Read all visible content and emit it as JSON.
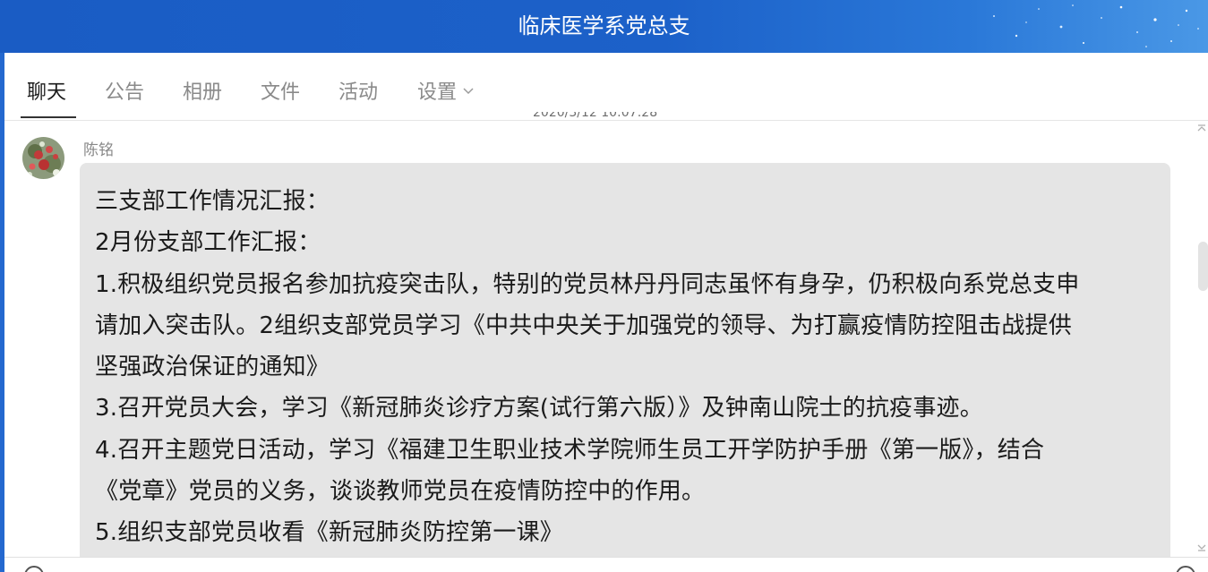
{
  "window": {
    "title": "临床医学系党总支"
  },
  "tabs": [
    {
      "label": "聊天",
      "active": true
    },
    {
      "label": "公告",
      "active": false
    },
    {
      "label": "相册",
      "active": false
    },
    {
      "label": "文件",
      "active": false
    },
    {
      "label": "活动",
      "active": false
    },
    {
      "label": "设置",
      "active": false
    }
  ],
  "chat": {
    "timestamp": "2020/3/12 10:07:28",
    "message": {
      "sender": "陈铭",
      "lines": [
        "三支部工作情况汇报：",
        "2月份支部工作汇报：",
        "1.积极组织党员报名参加抗疫突击队，特别的党员林丹丹同志虽怀有身孕，仍积极向系党总支申",
        "请加入突击队。2组织支部党员学习《中共中央关于加强党的领导、为打赢疫情防控阻击战提供",
        "坚强政治保证的通知》",
        "3.召开党员大会，学习《新冠肺炎诊疗方案(试行第六版）》及钟南山院士的抗疫事迹。",
        "4.召开主题党日活动，学习《福建卫生职业技术学院师生员工开学防护手册《第一版》，结合",
        "《党章》党员的义务，谈谈教师党员在疫情防控中的作用。",
        "5.组织支部党员收看《新冠肺炎防控第一课》"
      ]
    }
  },
  "colors": {
    "titlebar": "#1c61c9",
    "bubble": "#e5e5e5",
    "active_tab": "#1a1a1a",
    "inactive_tab": "#8a8a8a"
  },
  "icons": [
    "chevron-down-icon",
    "avatar-flower",
    "scroll-up-icon",
    "scroll-down-icon",
    "emoji-icon"
  ]
}
